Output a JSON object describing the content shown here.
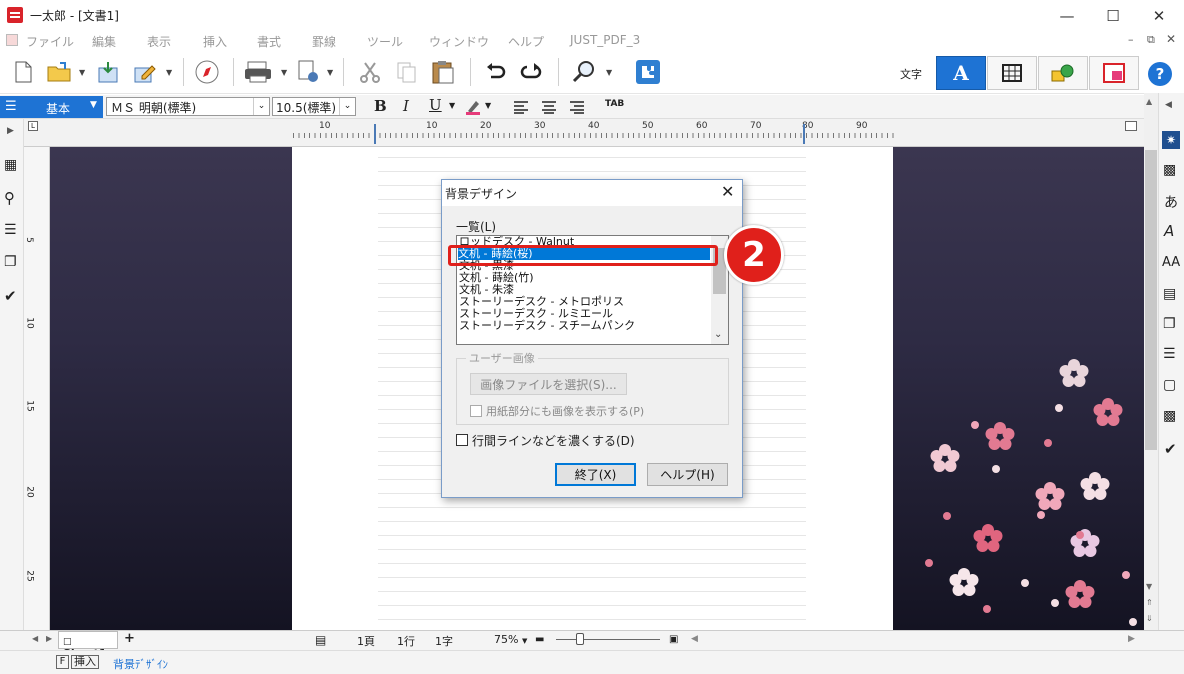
{
  "window": {
    "title": "一太郎 - [文書1]"
  },
  "menu": [
    "ファイル",
    "編集",
    "表示",
    "挿入",
    "書式",
    "罫線",
    "ツール",
    "ウィンドウ",
    "ヘルプ",
    "JUST_PDF_3"
  ],
  "toolbar": {
    "char_label": "文字"
  },
  "formatbar": {
    "style": "基本",
    "font": "ＭＳ 明朝(標準)",
    "size": "10.5(標準)"
  },
  "ruler": {
    "ticks": [
      "10",
      "10",
      "20",
      "30",
      "40",
      "50",
      "60",
      "70",
      "80",
      "90"
    ]
  },
  "vruler": {
    "ticks": [
      "5",
      "10",
      "15",
      "20",
      "25"
    ]
  },
  "dialog": {
    "title": "背景デザイン",
    "list_label": "一覧(L)",
    "items": [
      "ロッドデスク - Walnut",
      "文机 - 蒔絵(桜)",
      "文机 - 黒漆",
      "文机 - 蒔絵(竹)",
      "文机 - 朱漆",
      "ストーリーデスク - メトロポリス",
      "ストーリーデスク - ルミエール",
      "ストーリーデスク - スチームパンク"
    ],
    "selected_index": 1,
    "group_label": "ユーザー画像",
    "select_file_button": "画像ファイルを選択(S)...",
    "show_image_checkbox": "用紙部分にも画像を表示する(P)",
    "darken_lines_checkbox": "行間ラインなどを濃くする(D)",
    "close_button": "終了(X)",
    "help_button": "ヘルプ(H)"
  },
  "annotation": {
    "step": "2"
  },
  "sheetbar": {
    "tab": "Sheet1",
    "add": "+"
  },
  "status": {
    "page": "1頁",
    "line": "1行",
    "char": "1字",
    "zoom": "75%"
  },
  "footer": {
    "key": "F",
    "mode": "挿入",
    "action": "背景ﾃﾞｻﾞｲﾝ"
  },
  "colors": {
    "accent": "#0078d7",
    "highlight_box": "#e0201b",
    "step_badge": "#e0201b"
  }
}
